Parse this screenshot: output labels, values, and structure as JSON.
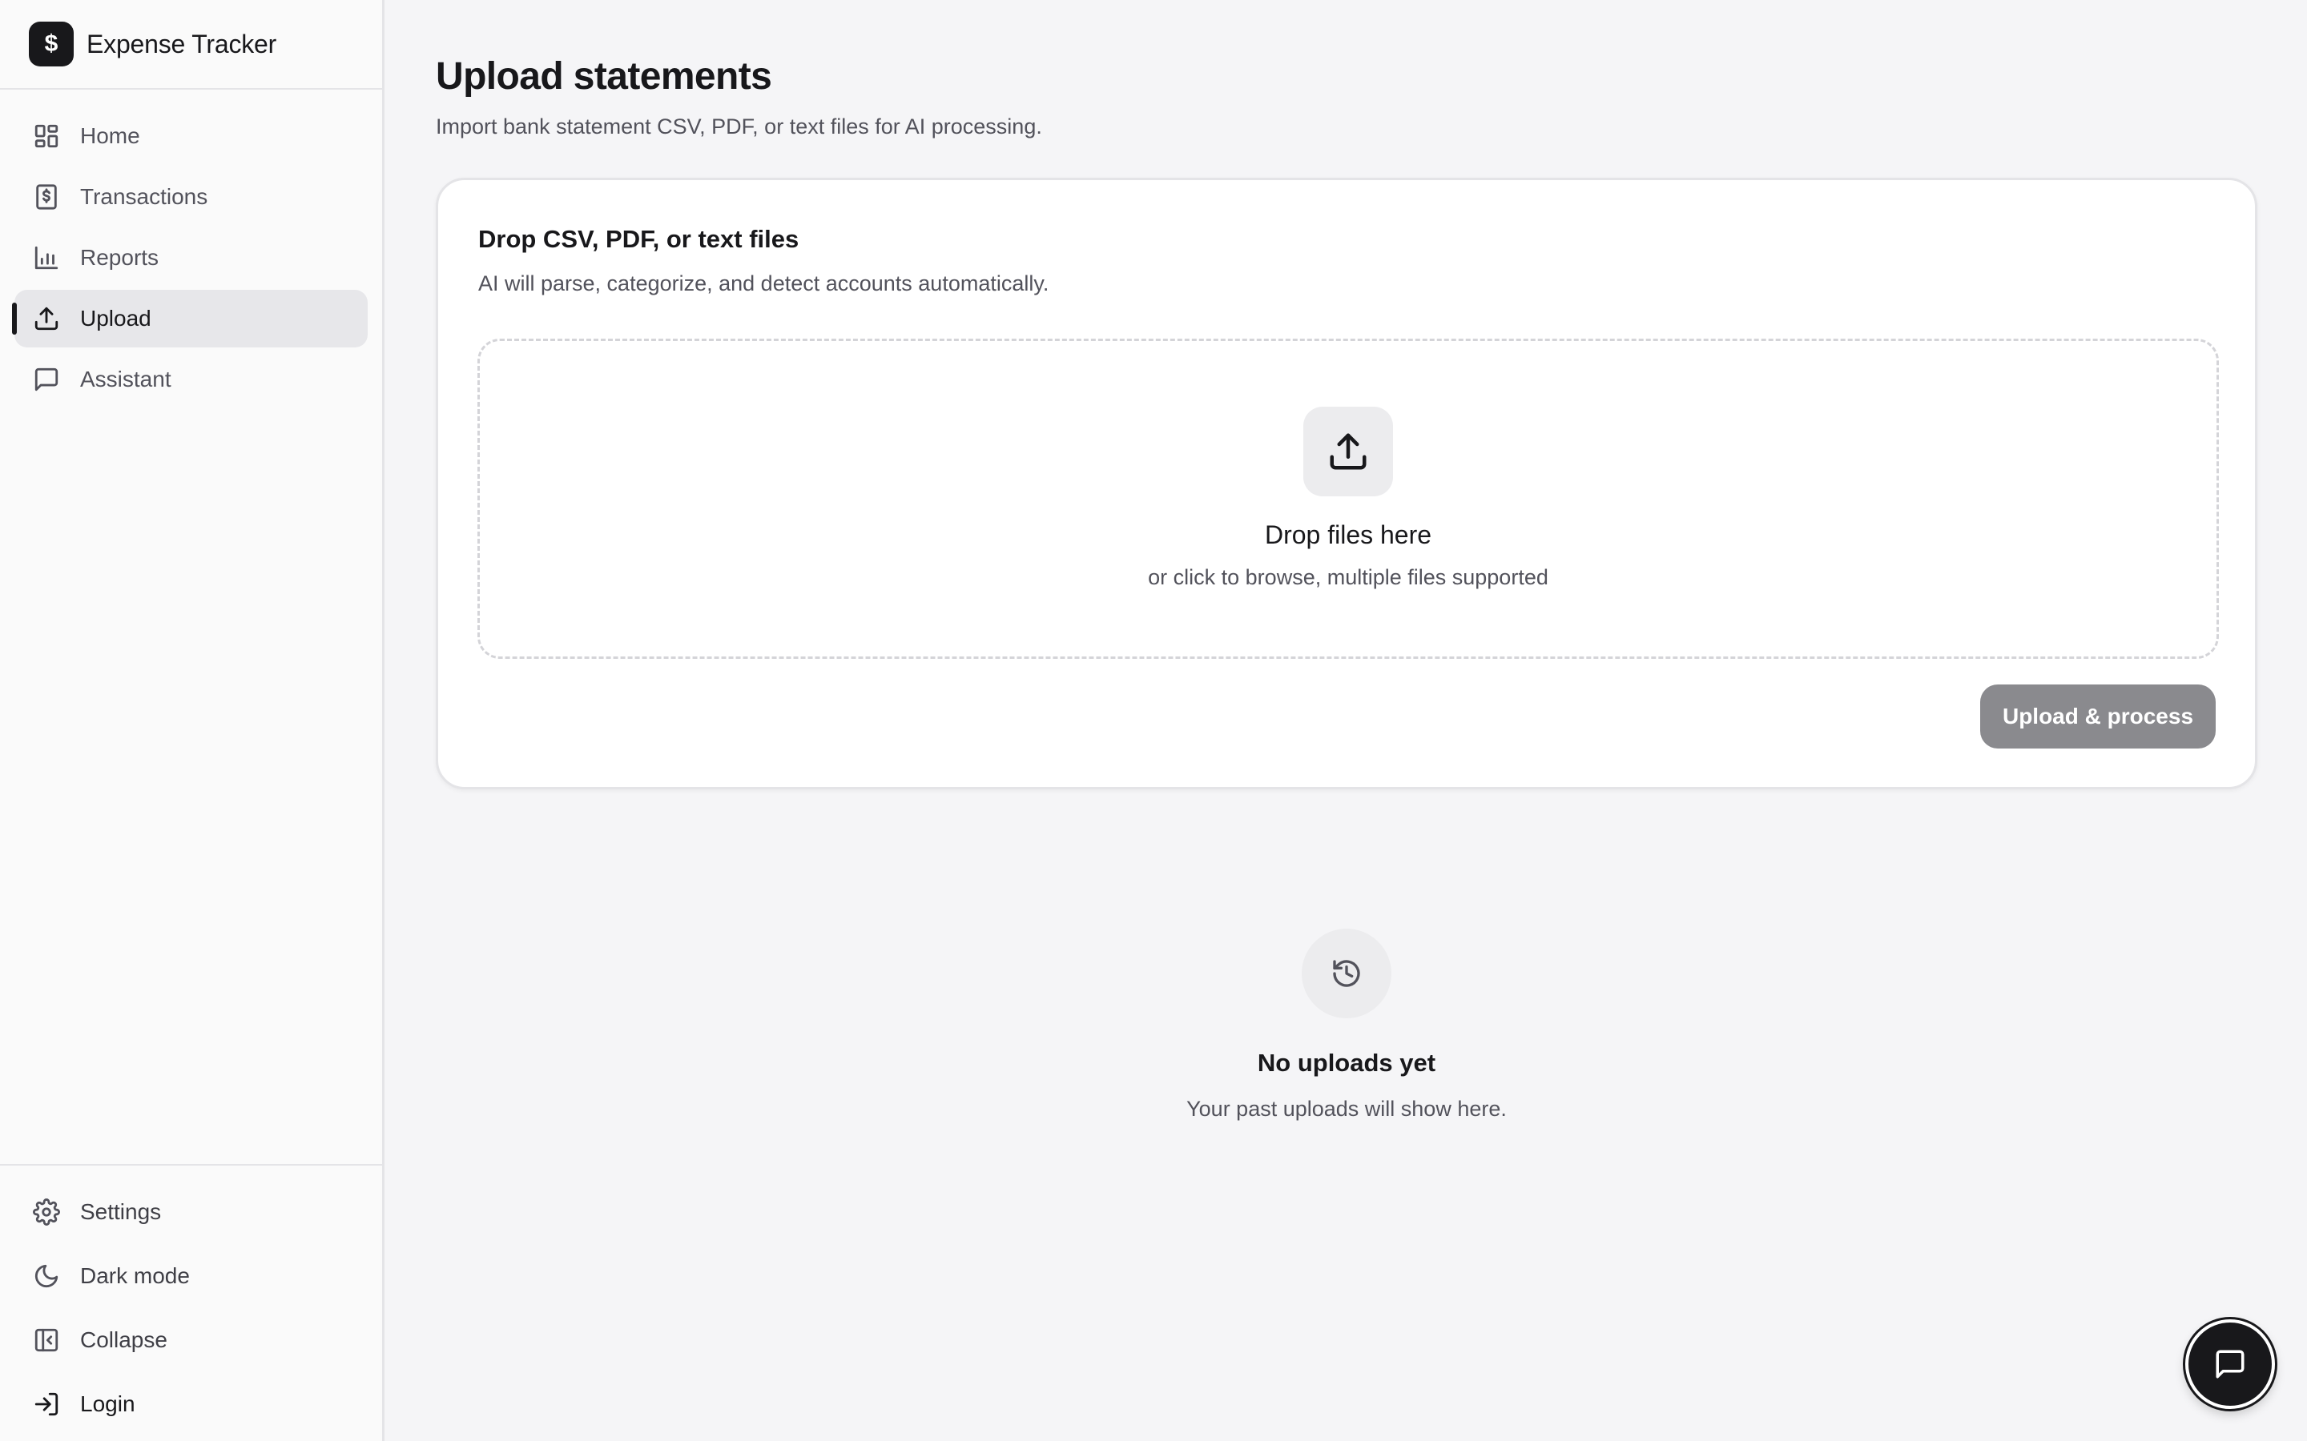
{
  "app": {
    "name": "Expense Tracker",
    "logo_glyph": "$"
  },
  "nav": {
    "items": [
      {
        "label": "Home",
        "icon": "dashboard-grid-icon",
        "active": false
      },
      {
        "label": "Transactions",
        "icon": "dollar-receipt-icon",
        "active": false
      },
      {
        "label": "Reports",
        "icon": "bar-chart-icon",
        "active": false
      },
      {
        "label": "Upload",
        "icon": "upload-icon",
        "active": true
      },
      {
        "label": "Assistant",
        "icon": "message-square-icon",
        "active": false
      }
    ],
    "bottom": [
      {
        "label": "Settings",
        "icon": "gear-icon"
      },
      {
        "label": "Dark mode",
        "icon": "moon-icon"
      },
      {
        "label": "Collapse",
        "icon": "sidebar-collapse-icon"
      },
      {
        "label": "Login",
        "icon": "login-icon"
      }
    ]
  },
  "page": {
    "title": "Upload statements",
    "subtitle": "Import bank statement CSV, PDF, or text files for AI processing."
  },
  "upload_card": {
    "title": "Drop CSV, PDF, or text files",
    "description": "AI will parse, categorize, and detect accounts automatically.",
    "dropzone_title": "Drop files here",
    "dropzone_subtitle": "or click to browse, multiple files supported",
    "button_label": "Upload & process"
  },
  "history": {
    "empty_title": "No uploads yet",
    "empty_subtitle": "Your past uploads will show here."
  },
  "colors": {
    "accent": "#18181b",
    "background": "#f5f5f7",
    "sidebar_bg": "#fafafa",
    "disabled_button": "#8a8a8e"
  }
}
